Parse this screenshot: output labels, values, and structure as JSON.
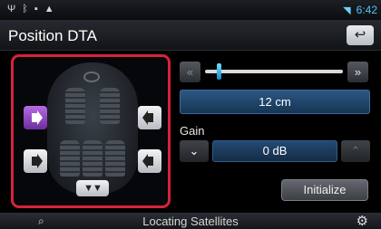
{
  "status": {
    "clock": "6:42",
    "icons": [
      "antenna-icon",
      "bluetooth-icon",
      "battery-icon",
      "warning-icon"
    ]
  },
  "header": {
    "title": "Position DTA"
  },
  "speakers": {
    "selected": "front-left",
    "items": [
      "front-left",
      "front-right",
      "rear-left",
      "rear-right",
      "subwoofer"
    ]
  },
  "distance": {
    "value": "12 cm",
    "left_arrow": "«",
    "right_arrow": "»",
    "slider_level": 0.1
  },
  "gain": {
    "label": "Gain",
    "value": "0 dB",
    "down_icon": "double-chevron-down-icon",
    "up_icon": "double-chevron-up-icon"
  },
  "buttons": {
    "initialize": "Initialize",
    "back_icon": "back-arrow-icon"
  },
  "footer": {
    "status": "Locating Satellites"
  }
}
